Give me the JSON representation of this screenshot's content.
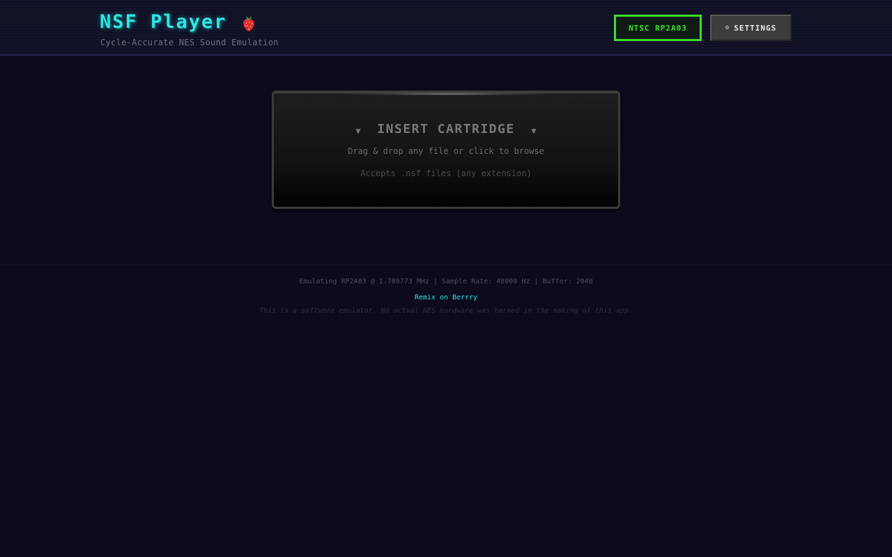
{
  "header": {
    "title": "NSF Player",
    "subtitle": "Cycle-Accurate NES Sound Emulation",
    "logo_icon": "strawberry-icon",
    "region_badge": "NTSC RP2A03",
    "settings_label": "SETTINGS",
    "settings_icon": "gear-icon"
  },
  "dropzone": {
    "heading": "INSERT CARTRIDGE",
    "instruction": "Drag & drop any file or click to browse",
    "accepts": "Accepts .nsf files (any extension)",
    "arrow_icon": "triangle-down-icon"
  },
  "footer": {
    "stats": "Emulating RP2A03 @ 1.789773 MHz | Sample Rate: 48000 Hz | Buffer: 2048",
    "link_label": "Remix on Berrry",
    "disclaimer": "This is a software emulator. No actual NES hardware was harmed in the making of this app."
  },
  "colors": {
    "background": "#0b0b1c",
    "accent_cyan": "#2ee6e6",
    "accent_green": "#3cde2b"
  }
}
